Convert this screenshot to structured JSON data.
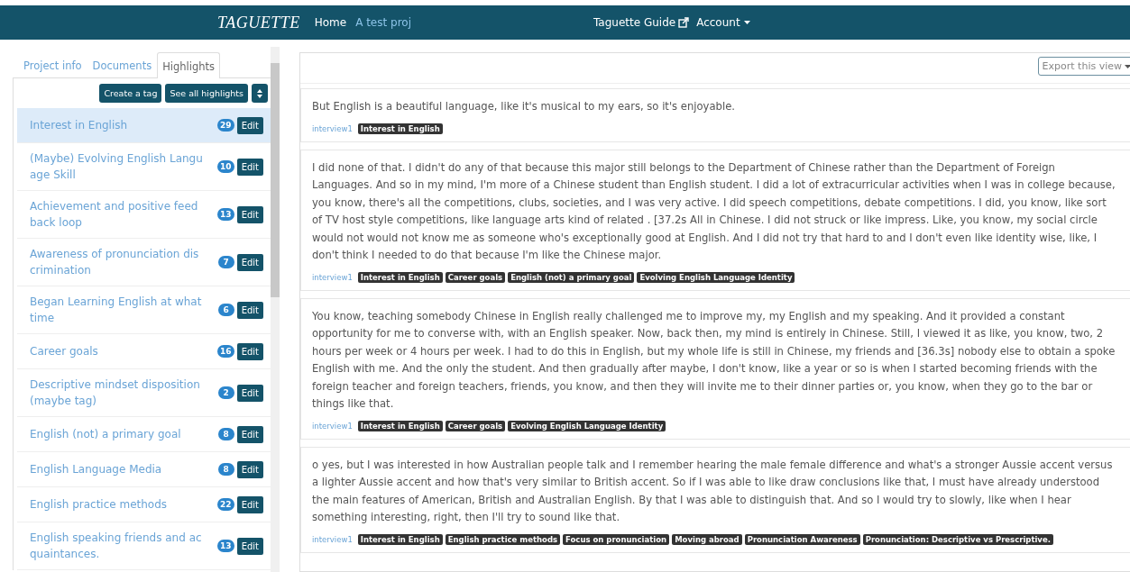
{
  "navbar": {
    "brand": "TAGUETTE",
    "links": [
      {
        "label": "Home",
        "selected": true
      },
      {
        "label": "A test proj",
        "selected": false
      }
    ],
    "guide": "Taguette Guide",
    "account": "Account"
  },
  "sidebar": {
    "tabs": [
      {
        "label": "Project info",
        "selected": false
      },
      {
        "label": "Documents",
        "selected": false
      },
      {
        "label": "Highlights",
        "selected": true
      }
    ],
    "buttons": [
      "Create a tag",
      "See all highlights"
    ],
    "tags": [
      {
        "name": "Interest in English",
        "count": "29",
        "edit": "Edit",
        "selected": true
      },
      {
        "name": "(Maybe) Evolving English Language Skill",
        "count": "10",
        "edit": "Edit",
        "selected": false
      },
      {
        "name": "Achievement and positive feedback loop",
        "count": "13",
        "edit": "Edit",
        "selected": false
      },
      {
        "name": "Awareness of pronunciation discrimination",
        "count": "7",
        "edit": "Edit",
        "selected": false
      },
      {
        "name": "Began Learning English at what time",
        "count": "6",
        "edit": "Edit",
        "selected": false
      },
      {
        "name": "Career goals",
        "count": "16",
        "edit": "Edit",
        "selected": false
      },
      {
        "name": "Descriptive mindset disposition (maybe tag)",
        "count": "2",
        "edit": "Edit",
        "selected": false
      },
      {
        "name": "English (not) a primary goal",
        "count": "8",
        "edit": "Edit",
        "selected": false
      },
      {
        "name": "English Language Media",
        "count": "8",
        "edit": "Edit",
        "selected": false
      },
      {
        "name": "English practice methods",
        "count": "22",
        "edit": "Edit",
        "selected": false
      },
      {
        "name": "English speaking friends and acquaintances.",
        "count": "13",
        "edit": "Edit",
        "selected": false
      }
    ]
  },
  "main": {
    "export": "Export this view",
    "highlights": [
      {
        "text": "But English is a beautiful language, like it's musical to my ears, so it's enjoyable.",
        "document": "interview1",
        "tags": [
          "Interest in English"
        ]
      },
      {
        "text": "I did none of that. I didn't do any of that because this major still belongs to the Department of Chinese rather than the Department of Foreign Languages. And so in my mind, I'm more of a Chinese student than English student. I did a lot of extracurricular activities when I was in college because, you know, there's all the competitions, clubs, societies, and I was very active. I did speech competitions, debate competitions. I did, you know, like sort of TV host style competitions, like language arts kind of related . [37.2s All in Chinese. I did not struck or like impress. Like, you know, my social circle would not would not know me as someone who's exceptionally good at English. And I did not try that hard to and I don't even like identity wise, like, I don't think I needed to do that because I'm like the Chinese major.",
        "document": "interview1",
        "tags": [
          "Interest in English",
          "Career goals",
          "English (not) a primary goal",
          "Evolving English Language Identity"
        ]
      },
      {
        "text": "You know, teaching somebody Chinese in English really challenged me to improve my, my English and my speaking. And it provided a constant opportunity for me to converse with, with an English speaker. Now, back then, my mind is entirely in Chinese. Still, I viewed it as like, you know, two, 2 hours per week or 4 hours per week. I had to do this in English, but my whole life is still in Chinese, my friends and [36.3s] nobody else to obtain a spoke English with me. And the only the student. And then gradually after maybe, I don't know, like a year or so is when I started becoming friends with the foreign teacher and foreign teachers, friends, you know, and then they will invite me to their dinner parties or, you know, when they go to the bar or things like that.",
        "document": "interview1",
        "tags": [
          "Interest in English",
          "Career goals",
          "Evolving English Language Identity"
        ]
      },
      {
        "text": "o yes, but I was interested in how Australian people talk and I remember hearing the male female difference and what's a stronger Aussie accent versus a lighter Aussie accent and how that's very similar to British accent. So if I was able to like draw conclusions like that, I must have already understood the main features of American, British and Australian English. By that I was able to distinguish that. And so I would try to slowly, like when I hear something interesting, right, then I'll try to sound like that.",
        "document": "interview1",
        "tags": [
          "Interest in English",
          "English practice methods",
          "Focus on pronunciation",
          "Moving abroad",
          "Pronunciation Awareness",
          "Pronunciation: Descriptive vs Prescriptive."
        ]
      }
    ]
  }
}
